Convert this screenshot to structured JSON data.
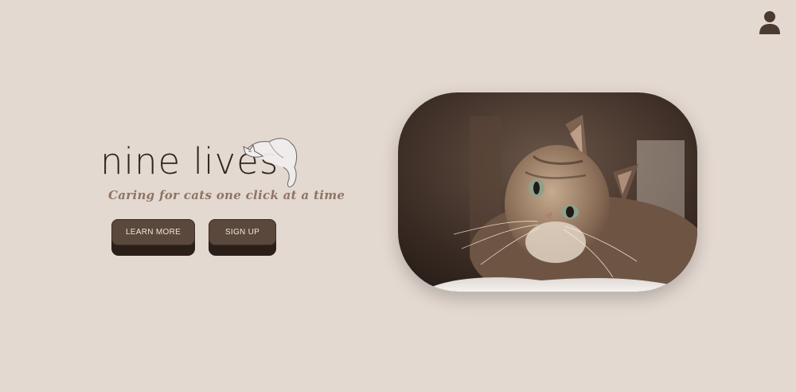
{
  "header": {
    "profile_icon": "user-icon"
  },
  "brand": {
    "logo_text": "nine lives",
    "tagline": "Caring for cats one click at a time",
    "logo_decoration": "sleeping-cat-icon"
  },
  "actions": {
    "learn_more_label": "LEARN MORE",
    "sign_up_label": "SIGN UP"
  },
  "hero": {
    "image": "cat-photo"
  },
  "colors": {
    "background": "#e4d9d1",
    "button": "#5a483d",
    "button_shadow": "#2a1f19",
    "text_dark": "#2f2622",
    "tagline": "#8e7464"
  }
}
